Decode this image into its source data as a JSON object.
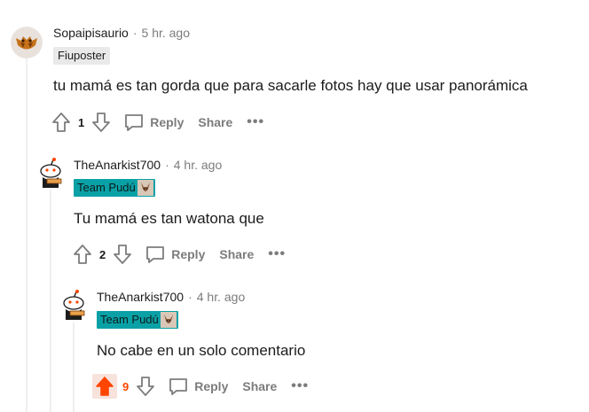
{
  "comments": [
    {
      "username": "Sopaipisaurio",
      "time": "5 hr. ago",
      "flair": "Fiuposter",
      "body": "tu mamá es tan gorda que para sacarle fotos hay que usar panorámica",
      "score": "1",
      "upvoted": false
    },
    {
      "username": "TheAnarkist700",
      "time": "4 hr. ago",
      "flair": "Team Pudú",
      "body": "Tu mamá es tan watona que",
      "score": "2",
      "upvoted": false
    },
    {
      "username": "TheAnarkist700",
      "time": "4 hr. ago",
      "flair": "Team Pudú",
      "body": "No cabe en un solo comentario",
      "score": "9",
      "upvoted": true
    }
  ],
  "actions": {
    "separator": "·",
    "reply_label": "Reply",
    "share_label": "Share",
    "more_label": "•••"
  },
  "colors": {
    "upvote_active": "#ff4500",
    "flair_teal": "#0aa1a6",
    "muted": "#7c7c7c"
  }
}
